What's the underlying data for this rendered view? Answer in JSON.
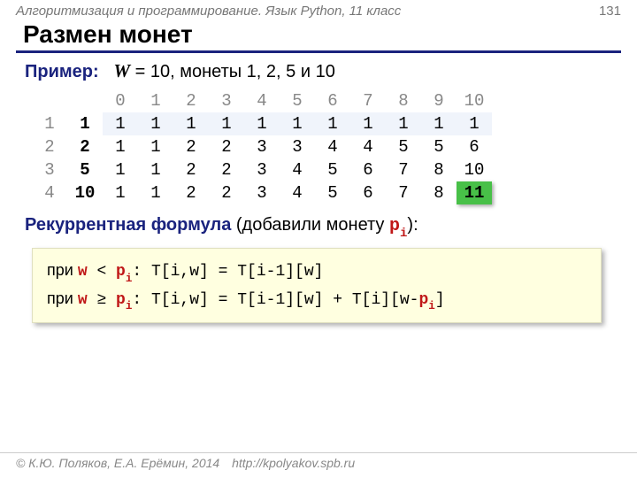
{
  "header": {
    "breadcrumb": "Алгоритмизация и программирование. Язык Python, 11 класс",
    "page_number": "131"
  },
  "title": "Размен монет",
  "example": {
    "label": "Пример:",
    "text_w": "W",
    "text_eq": " = 10, монеты 1, 2, 5 и 10"
  },
  "table": {
    "col_headers": [
      "0",
      "1",
      "2",
      "3",
      "4",
      "5",
      "6",
      "7",
      "8",
      "9",
      "10"
    ],
    "rows": [
      {
        "idx": "1",
        "coin": "1",
        "cells": [
          "1",
          "1",
          "1",
          "1",
          "1",
          "1",
          "1",
          "1",
          "1",
          "1",
          "1"
        ],
        "hi": true
      },
      {
        "idx": "2",
        "coin": "2",
        "cells": [
          "1",
          "1",
          "2",
          "2",
          "3",
          "3",
          "4",
          "4",
          "5",
          "5",
          "6"
        ],
        "hi": false
      },
      {
        "idx": "3",
        "coin": "5",
        "cells": [
          "1",
          "1",
          "2",
          "2",
          "3",
          "4",
          "5",
          "6",
          "7",
          "8",
          "10"
        ],
        "hi": false
      },
      {
        "idx": "4",
        "coin": "10",
        "cells": [
          "1",
          "1",
          "2",
          "2",
          "3",
          "4",
          "5",
          "6",
          "7",
          "8",
          "11"
        ],
        "hi": false,
        "final_last": true
      }
    ]
  },
  "recurrence": {
    "label": "Рекуррентная формула",
    "rest": " (добавили монету ",
    "coin": "p",
    "coin_sub": "i",
    "end": "):"
  },
  "formula": {
    "line1_pre": "при ",
    "w": "w",
    "lt": " < ",
    "p": "p",
    "psub": "i",
    "line1_post": ": T[i,w] = T[i-1][w]",
    "line2_pre": "при ",
    "ge": " ≥ ",
    "line2_post": ": T[i,w] = T[i-1][w] + T[i][w-",
    "line2_close": "]"
  },
  "footer": {
    "copyright": "© К.Ю. Поляков, Е.А. Ерёмин, 2014",
    "url": "http://kpolyakov.spb.ru"
  }
}
